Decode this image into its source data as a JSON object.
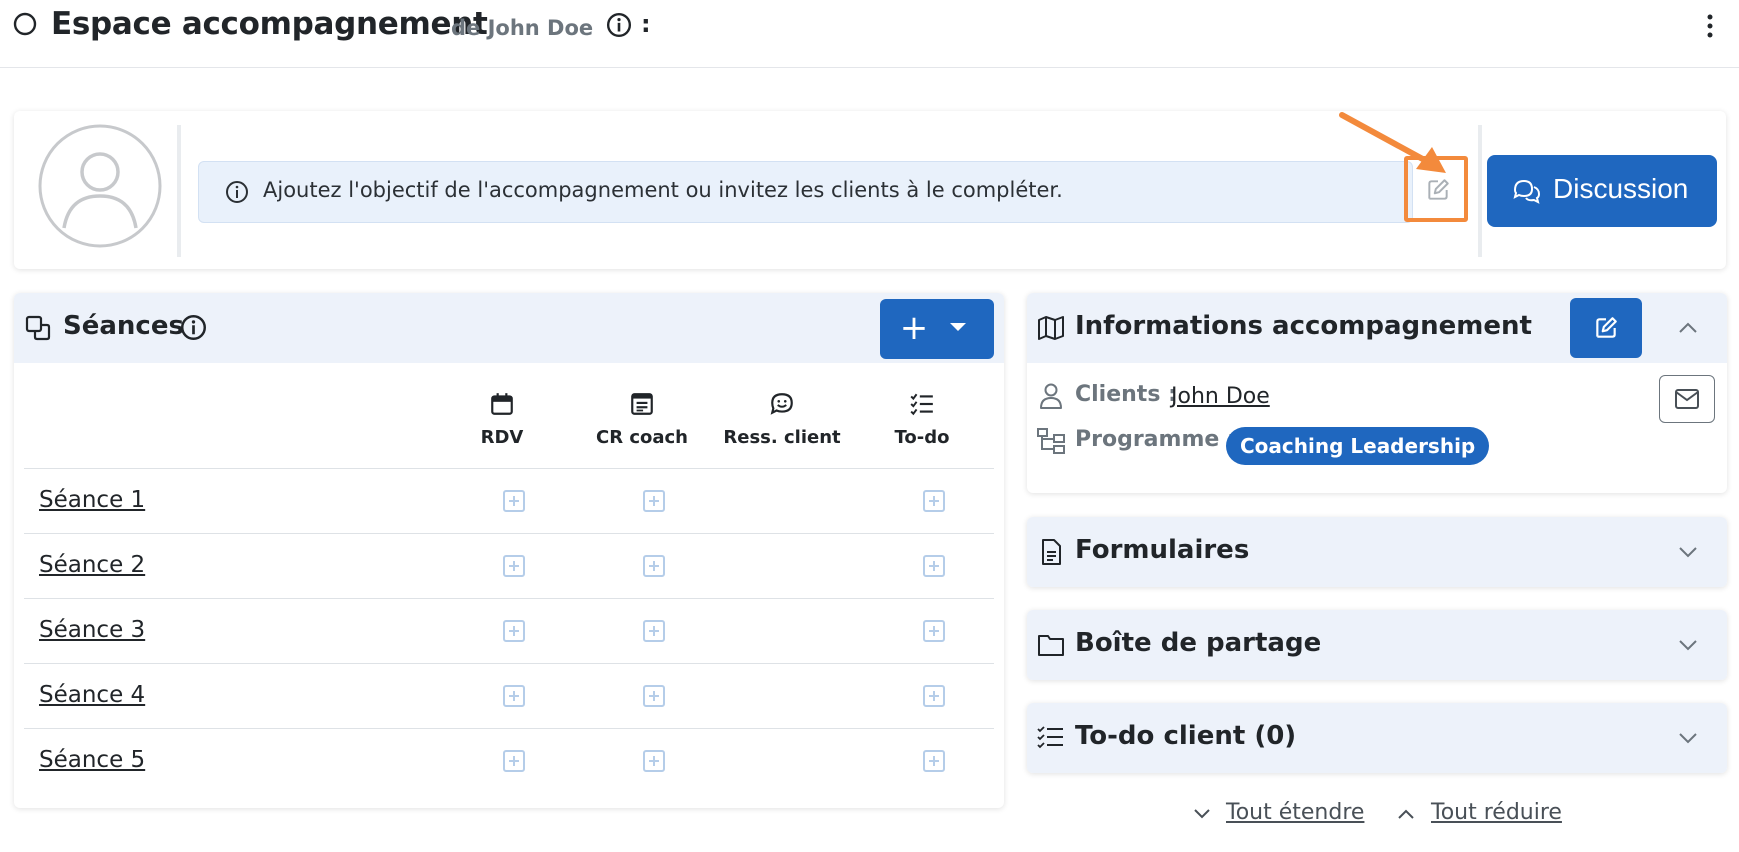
{
  "header": {
    "title": "Espace accompagnement",
    "subtitle": "de John Doe",
    "colon": ":"
  },
  "objective": {
    "text": "Ajoutez l'objectif de l'accompagnement ou invitez les clients à le compléter."
  },
  "discussion": {
    "label": "Discussion"
  },
  "seances": {
    "title": "Séances",
    "add_label": "+",
    "columns": [
      {
        "label": "RDV",
        "icon": "calendar-icon"
      },
      {
        "label": "CR coach",
        "icon": "report-icon"
      },
      {
        "label": "Ress. client",
        "icon": "smile-chat-icon"
      },
      {
        "label": "To-do",
        "icon": "checklist-icon"
      }
    ],
    "rows": [
      {
        "name": "Séance 1"
      },
      {
        "name": "Séance 2"
      },
      {
        "name": "Séance 3"
      },
      {
        "name": "Séance 4"
      },
      {
        "name": "Séance 5"
      }
    ]
  },
  "info_panel": {
    "title": "Informations accompagnement",
    "clients_label": "Clients :",
    "client_name": "John Doe",
    "programme_label": "Programme :",
    "programme_value": "Coaching Leadership"
  },
  "panels": {
    "formulaires": "Formulaires",
    "boite": "Boîte de partage",
    "todo": "To-do client (0)"
  },
  "footer": {
    "expand_all": "Tout étendre",
    "collapse_all": "Tout réduire"
  },
  "colors": {
    "primary": "#1f67bf",
    "annotation": "#f38a3c",
    "panel_header": "#edf2fa",
    "objective_bg": "#e9f1fb"
  }
}
